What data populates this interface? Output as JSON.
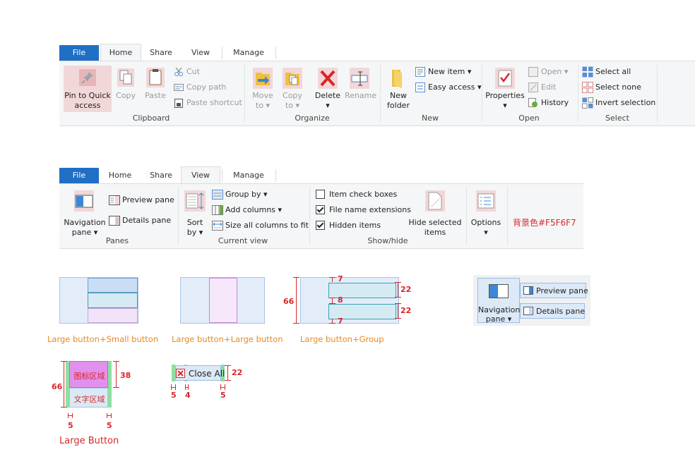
{
  "ribbon1": {
    "tabs": [
      "File",
      "Home",
      "Share",
      "View",
      "Manage"
    ],
    "clipboard": {
      "pin_label_1": "Pin to Quick",
      "pin_label_2": "access",
      "copy": "Copy",
      "paste": "Paste",
      "cut": "Cut",
      "copy_path": "Copy path",
      "paste_shortcut": "Paste shortcut",
      "group": "Clipboard"
    },
    "organize": {
      "move_to": "Move",
      "move_to_2": "to",
      "copy_to": "Copy",
      "copy_to_2": "to",
      "delete": "Delete",
      "rename": "Rename",
      "group": "Organize"
    },
    "new": {
      "new_folder_1": "New",
      "new_folder_2": "folder",
      "new_item": "New item",
      "easy_access": "Easy access",
      "group": "New"
    },
    "open": {
      "properties": "Properties",
      "open": "Open",
      "edit": "Edit",
      "history": "History",
      "group": "Open"
    },
    "select": {
      "select_all": "Select all",
      "select_none": "Select none",
      "invert": "Invert selection",
      "group": "Select"
    }
  },
  "ribbon2": {
    "tabs": [
      "File",
      "Home",
      "Share",
      "View",
      "Manage"
    ],
    "panes": {
      "nav_1": "Navigation",
      "nav_2": "pane",
      "preview": "Preview pane",
      "details": "Details pane",
      "group": "Panes"
    },
    "current_view": {
      "sort_1": "Sort",
      "sort_2": "by",
      "group_by": "Group by",
      "add_columns": "Add columns",
      "size_all": "Size all columns to fit",
      "group": "Current view"
    },
    "show_hide": {
      "item_check_boxes": "Item check boxes",
      "file_name_extensions": "File name extensions",
      "hidden_items": "Hidden items",
      "hide_selected_1": "Hide selected",
      "hide_selected_2": "items",
      "group": "Show/hide"
    },
    "options": {
      "label": "Options"
    },
    "bg_note": "背景色#F5F6F7"
  },
  "diagrams": {
    "caption_1": "Large button+Small button",
    "caption_2": "Large button+Large button",
    "caption_3": "Large button+Group",
    "dim_7_top": "7",
    "dim_22_a": "22",
    "dim_8": "8",
    "dim_22_b": "22",
    "dim_7_bottom": "7",
    "dim_66": "66",
    "sample": {
      "nav_1": "Navigation",
      "nav_2": "pane",
      "preview": "Preview pane",
      "details": "Details pane"
    },
    "large_button": {
      "icon_area": "图标区域",
      "text_area": "文字区域",
      "dim_38": "38",
      "dim_66": "66",
      "dim_5_left": "5",
      "dim_5_right": "5",
      "caption": "Large Button"
    },
    "close_all": {
      "label": "Close All",
      "dim_22": "22",
      "dim_5_a": "5",
      "dim_4": "4",
      "dim_5_b": "5"
    }
  },
  "colors": {
    "file_tab": "#1f6fc5",
    "ribbon_bg": "#f5f6f7",
    "annotation": "#d8262b",
    "caption": "#e98a24",
    "blue_fill": "#dce9f7",
    "purple_fill": "#f3e3f7"
  }
}
